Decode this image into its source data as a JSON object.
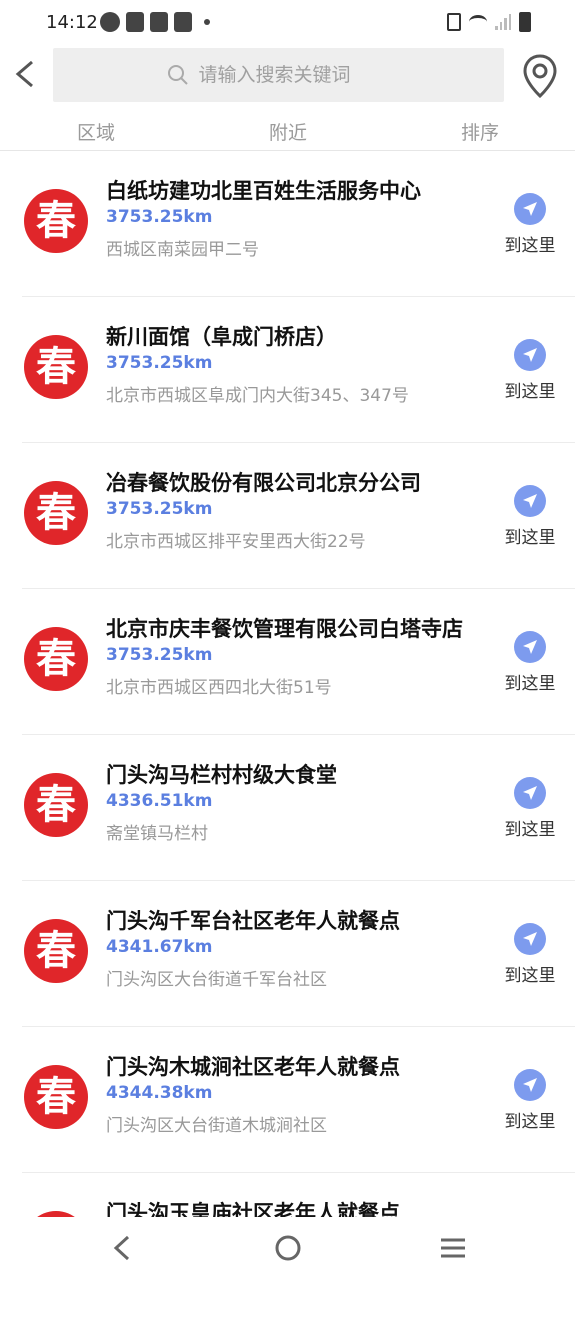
{
  "status": {
    "time": "14:12"
  },
  "search": {
    "placeholder": "请输入搜索关键词"
  },
  "filters": [
    "区域",
    "附近",
    "排序"
  ],
  "logo_char": "春",
  "go_label": "到这里",
  "colors": {
    "logo_red": "#e0262a",
    "distance_blue": "#5b7fe0",
    "nav_button_blue": "#7d9bee"
  },
  "items": [
    {
      "name": "白纸坊建功北里百姓生活服务中心",
      "distance": "3753.25km",
      "address": "西城区南菜园甲二号"
    },
    {
      "name": "新川面馆（阜成门桥店）",
      "distance": "3753.25km",
      "address": "北京市西城区阜成门内大街345、347号"
    },
    {
      "name": "冶春餐饮股份有限公司北京分公司",
      "distance": "3753.25km",
      "address": "北京市西城区排平安里西大街22号"
    },
    {
      "name": "北京市庆丰餐饮管理有限公司白塔寺店",
      "distance": "3753.25km",
      "address": "北京市西城区西四北大街51号"
    },
    {
      "name": "门头沟马栏村村级大食堂",
      "distance": "4336.51km",
      "address": "斋堂镇马栏村"
    },
    {
      "name": "门头沟千军台社区老年人就餐点",
      "distance": "4341.67km",
      "address": "门头沟区大台街道千军台社区"
    },
    {
      "name": "门头沟木城涧社区老年人就餐点",
      "distance": "4344.38km",
      "address": "门头沟区大台街道木城涧社区"
    },
    {
      "name": "门头沟玉皇庙社区老年人就餐点",
      "distance": "",
      "address": ""
    }
  ]
}
